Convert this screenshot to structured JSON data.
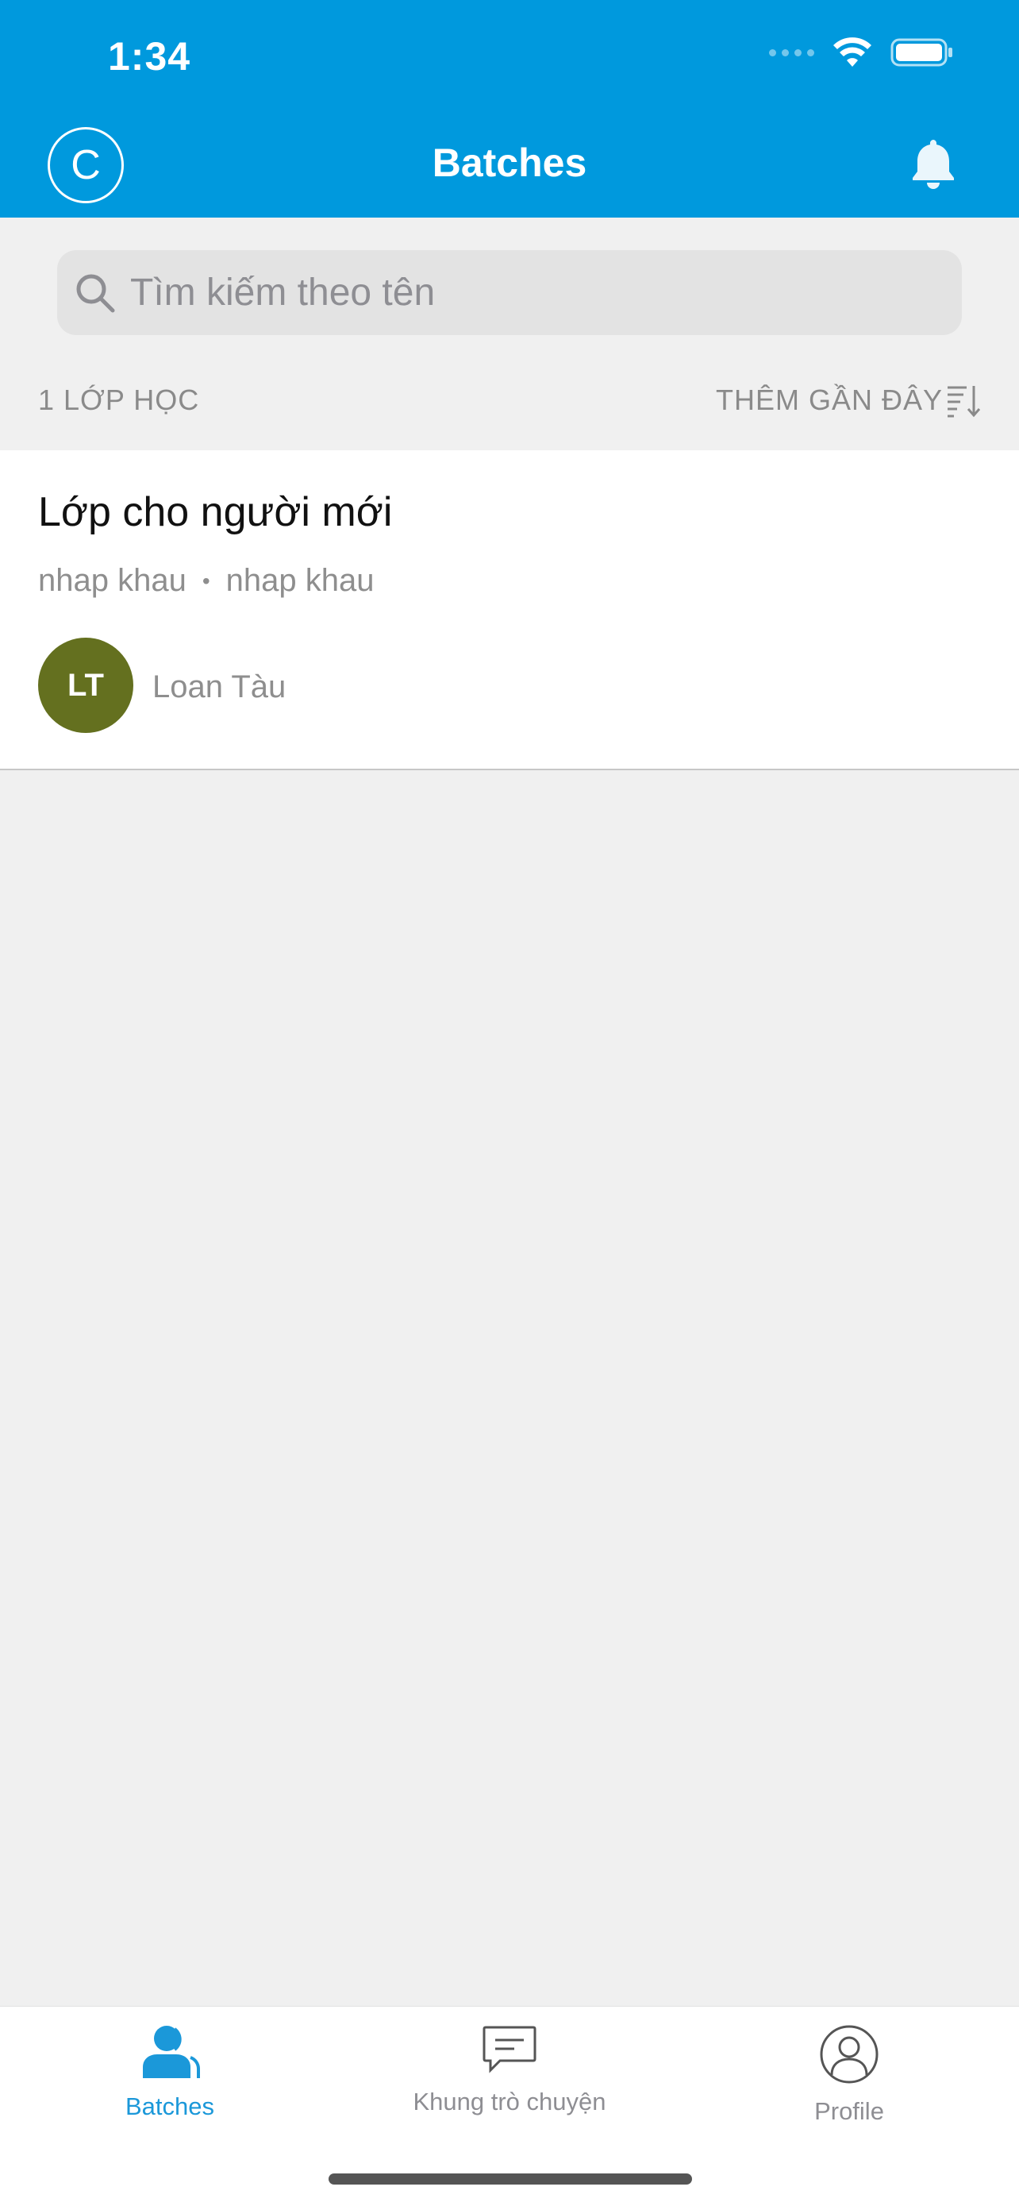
{
  "status_bar": {
    "time": "1:34"
  },
  "nav": {
    "avatar_initial": "C",
    "title": "Batches"
  },
  "search": {
    "placeholder": "Tìm kiếm theo tên",
    "value": ""
  },
  "list_header": {
    "count_label": "1 LỚP HỌC",
    "sort_label": "THÊM GẦN ĐÂY"
  },
  "batches": [
    {
      "title": "Lớp cho người mới",
      "subtitle_left": "nhap khau",
      "subtitle_separator": "•",
      "subtitle_right": "nhap khau",
      "owner_initials": "LT",
      "owner_name": "Loan Tàu"
    }
  ],
  "tabs": [
    {
      "label": "Batches",
      "icon": "batches-icon",
      "active": true
    },
    {
      "label": "Khung trò chuyện",
      "icon": "chat-icon",
      "active": false
    },
    {
      "label": "Profile",
      "icon": "profile-icon",
      "active": false
    }
  ],
  "colors": {
    "header": "#0099dd",
    "tab_active": "#1b98d9",
    "tab_inactive": "#8e8e93",
    "owner_avatar": "#64701f",
    "background": "#f0f0f0"
  }
}
